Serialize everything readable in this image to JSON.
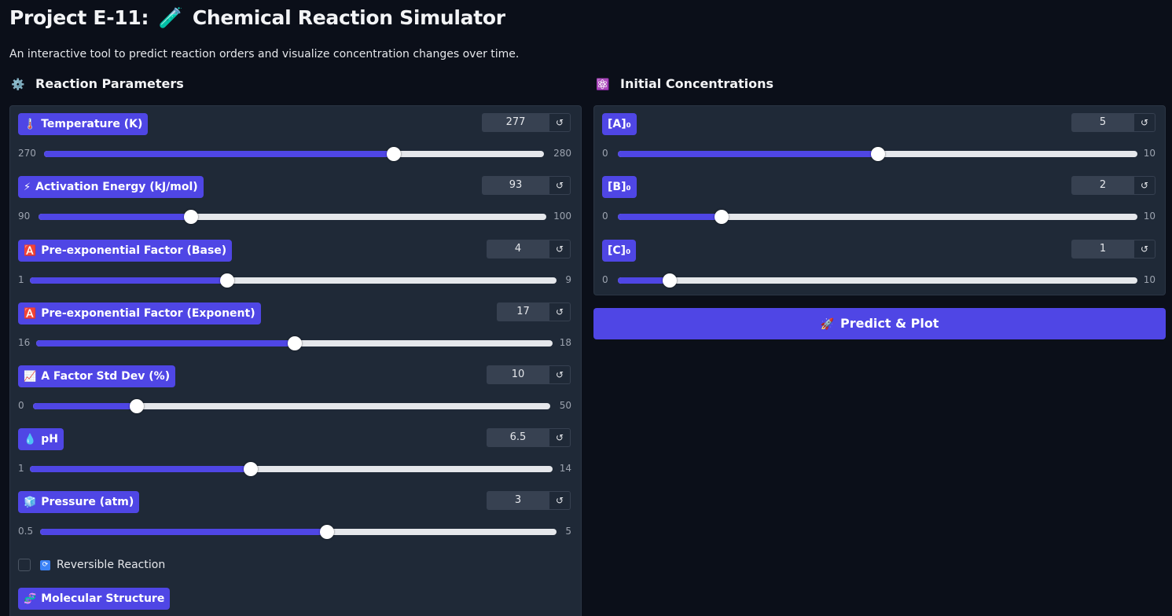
{
  "title": {
    "prefix": "Project E-11:",
    "icon": "🧪",
    "text": "Chemical Reaction Simulator"
  },
  "subtitle": "An interactive tool to predict reaction orders and visualize concentration changes over time.",
  "reaction_parameters": {
    "icon": "⚙️",
    "heading": "Reaction Parameters",
    "sliders": [
      {
        "icon": "🌡️",
        "label": "Temperature (K)",
        "value": "277",
        "min": "270",
        "max": "280",
        "fraction": 0.7
      },
      {
        "icon": "⚡",
        "label": "Activation Energy (kJ/mol)",
        "value": "93",
        "min": "90",
        "max": "100",
        "fraction": 0.3
      },
      {
        "icon": "🅰️",
        "label": "Pre-exponential Factor (Base)",
        "value": "4",
        "min": "1",
        "max": "9",
        "fraction": 0.375
      },
      {
        "icon": "🅰️",
        "label": "Pre-exponential Factor (Exponent)",
        "value": "17",
        "min": "16",
        "max": "18",
        "fraction": 0.5
      },
      {
        "icon": "📈",
        "label": "A Factor Std Dev (%)",
        "value": "10",
        "min": "0",
        "max": "50",
        "fraction": 0.2
      },
      {
        "icon": "💧",
        "label": "pH",
        "value": "6.5",
        "min": "1",
        "max": "14",
        "fraction": 0.4231
      },
      {
        "icon": "🧊",
        "label": "Pressure (atm)",
        "value": "3",
        "min": "0.5",
        "max": "5",
        "fraction": 0.5556
      }
    ],
    "reversible": {
      "icon": "🔄",
      "label": "Reversible Reaction",
      "checked": false
    },
    "molecular_structure": {
      "icon": "🧬",
      "label": "Molecular Structure"
    }
  },
  "initial_concentrations": {
    "icon": "⚛️",
    "heading": "Initial Concentrations",
    "sliders": [
      {
        "label": "[A]₀",
        "value": "5",
        "min": "0",
        "max": "10",
        "fraction": 0.5
      },
      {
        "label": "[B]₀",
        "value": "2",
        "min": "0",
        "max": "10",
        "fraction": 0.2
      },
      {
        "label": "[C]₀",
        "value": "1",
        "min": "0",
        "max": "10",
        "fraction": 0.1
      }
    ]
  },
  "predict_button": {
    "icon": "🚀",
    "label": "Predict & Plot"
  },
  "reset_symbol": "↺",
  "colors": {
    "accent": "#4f46e5",
    "panel": "#1f2937",
    "background": "#0b0f19"
  }
}
